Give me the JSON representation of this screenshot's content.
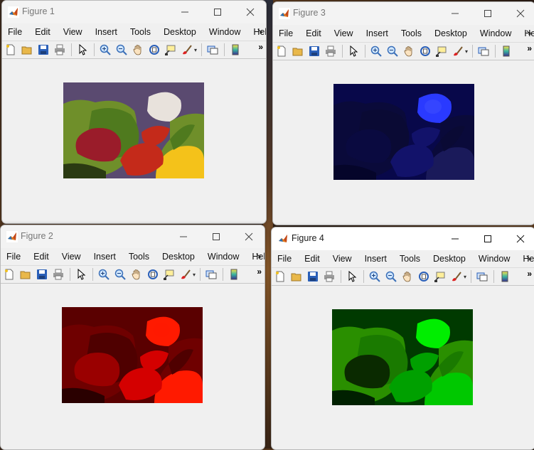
{
  "windows": [
    {
      "id": "fig1",
      "title": "Figure 1",
      "channel": "rgb"
    },
    {
      "id": "fig3",
      "title": "Figure 3",
      "channel": "blue"
    },
    {
      "id": "fig2",
      "title": "Figure 2",
      "channel": "red"
    },
    {
      "id": "fig4",
      "title": "Figure 4",
      "channel": "green"
    }
  ],
  "menu": [
    "File",
    "Edit",
    "View",
    "Insert",
    "Tools",
    "Desktop",
    "Window",
    "Help"
  ],
  "menu_overflow": "↘",
  "toolbar_overflow": "»",
  "toolbar_icons": [
    "new-figure-icon",
    "open-file-icon",
    "save-icon",
    "print-icon",
    "select-arrow-icon",
    "zoom-in-icon",
    "zoom-out-icon",
    "pan-hand-icon",
    "rotate-3d-icon",
    "data-cursor-icon",
    "brush-icon",
    "link-plot-icon",
    "colorbar-icon"
  ],
  "colors": {
    "matlab_orange": "#e07a1f",
    "red_channel": "#ff1a00",
    "green_channel": "#00e000",
    "blue_channel": "#1a28ff"
  }
}
